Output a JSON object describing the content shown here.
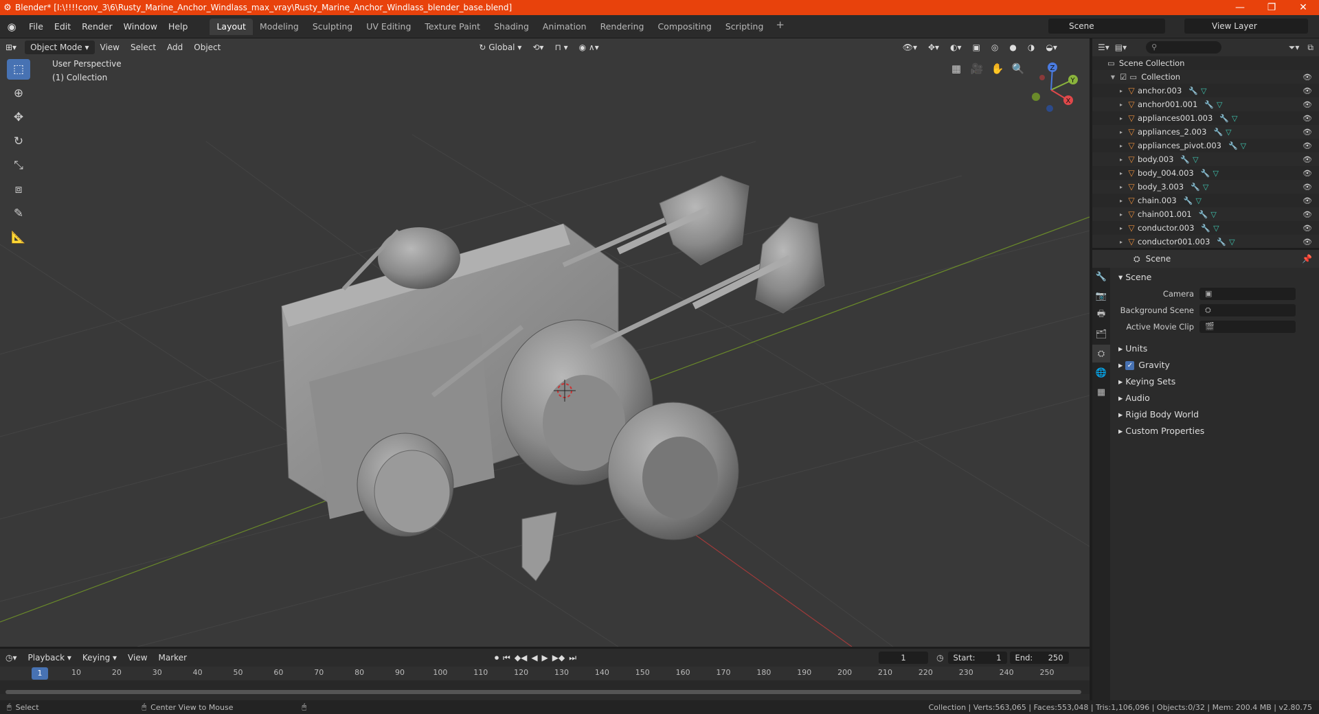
{
  "window": {
    "title": "Blender* [I:\\!!!!conv_3\\6\\Rusty_Marine_Anchor_Windlass_max_vray\\Rusty_Marine_Anchor_Windlass_blender_base.blend]",
    "controls": [
      "—",
      "❐",
      "✕"
    ]
  },
  "menubar": {
    "items": [
      "File",
      "Edit",
      "Render",
      "Window",
      "Help"
    ],
    "workspaces": [
      "Layout",
      "Modeling",
      "Sculpting",
      "UV Editing",
      "Texture Paint",
      "Shading",
      "Animation",
      "Rendering",
      "Compositing",
      "Scripting"
    ],
    "active_workspace": "Layout",
    "scene": "Scene",
    "view_layer": "View Layer"
  },
  "viewport": {
    "mode": "Object Mode",
    "menus": [
      "View",
      "Select",
      "Add",
      "Object"
    ],
    "transform_orientation": "Global",
    "perspective_label": "User Perspective",
    "collection_label": "(1) Collection",
    "gizmo_axes": [
      "X",
      "Y",
      "Z"
    ]
  },
  "outliner": {
    "root": "Scene Collection",
    "collection": "Collection",
    "objects": [
      "anchor.003",
      "anchor001.001",
      "appliances001.003",
      "appliances_2.003",
      "appliances_pivot.003",
      "body.003",
      "body_004.003",
      "body_3.003",
      "chain.003",
      "chain001.001",
      "conductor.003",
      "conductor001.003"
    ]
  },
  "properties": {
    "context": "Scene",
    "panel": "Scene",
    "rows": [
      {
        "label": "Camera"
      },
      {
        "label": "Background Scene"
      },
      {
        "label": "Active Movie Clip"
      }
    ],
    "subpanels": [
      "Units",
      "Gravity",
      "Keying Sets",
      "Audio",
      "Rigid Body World",
      "Custom Properties"
    ]
  },
  "timeline": {
    "menus": [
      "Playback",
      "Keying",
      "View",
      "Marker"
    ],
    "current_frame": "1",
    "start_label": "Start:",
    "start": "1",
    "end_label": "End:",
    "end": "250",
    "ticks": [
      "1",
      "10",
      "20",
      "30",
      "40",
      "50",
      "60",
      "70",
      "80",
      "90",
      "100",
      "110",
      "120",
      "130",
      "140",
      "150",
      "160",
      "170",
      "180",
      "190",
      "200",
      "210",
      "220",
      "230",
      "240",
      "250"
    ]
  },
  "statusbar": {
    "left": "Select",
    "middle": "Center View to Mouse",
    "stats": "Collection | Verts:563,065 | Faces:553,048 | Tris:1,106,096 | Objects:0/32 | Mem: 200.4 MB | v2.80.75"
  }
}
